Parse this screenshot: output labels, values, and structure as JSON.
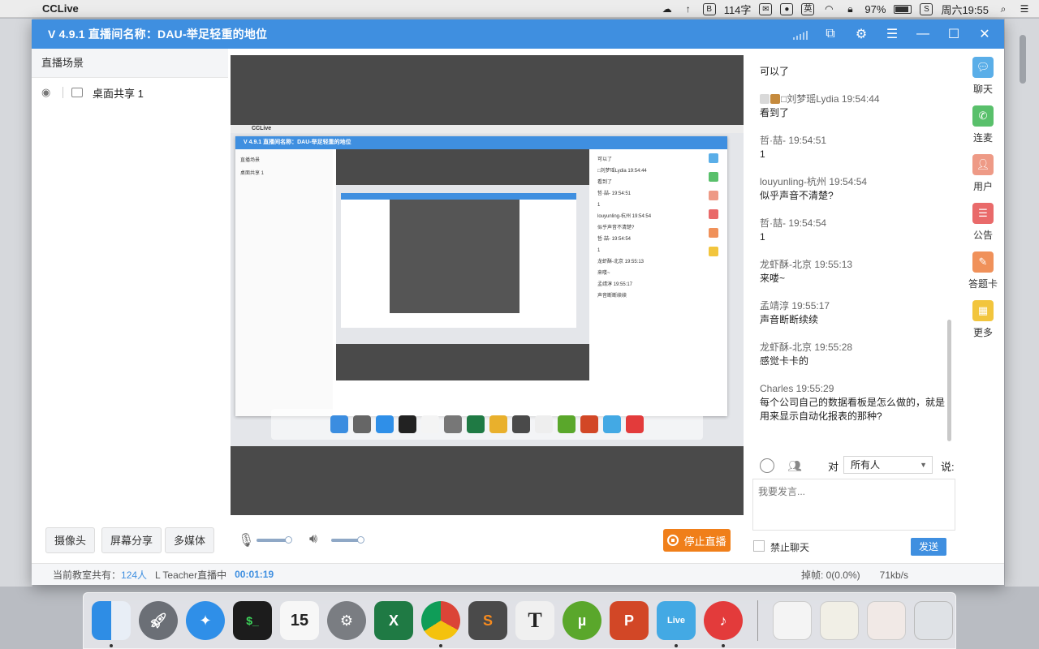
{
  "menubar": {
    "app_name": "CCLive",
    "word_count": "114字",
    "input_method": "英",
    "battery": "97%",
    "clock": "周六19:55"
  },
  "window": {
    "title": "V 4.9.1  直播间名称：DAU-举足轻重的地位"
  },
  "scene_panel": {
    "header": "直播场景",
    "items": [
      {
        "label": "桌面共享 1"
      }
    ]
  },
  "controls": {
    "camera": "摄像头",
    "screen_share": "屏幕分享",
    "multimedia": "多媒体",
    "stop_live": "停止直播"
  },
  "status_bar": {
    "room_prefix": "当前教室共有：",
    "room_count": "124人",
    "teacher_status": "L Teacher直播中",
    "elapsed": "00:01:19",
    "frame_drop": "掉帧: 0(0.0%)",
    "bitrate": "71kb/s"
  },
  "chat": {
    "messages": [
      {
        "meta": "",
        "body": "可以了"
      },
      {
        "meta": "□刘梦瑶Lydia 19:54:44",
        "body": "看到了"
      },
      {
        "meta": "哲·喆- 19:54:51",
        "body": "1"
      },
      {
        "meta": "louyunling-杭州 19:54:54",
        "body": "似乎声音不清楚?"
      },
      {
        "meta": "哲·喆- 19:54:54",
        "body": "1"
      },
      {
        "meta": "龙虾酥-北京 19:55:13",
        "body": "来喽~"
      },
      {
        "meta": "孟靖淳 19:55:17",
        "body": "声音断断续续"
      },
      {
        "meta": "龙虾酥-北京 19:55:28",
        "body": "感觉卡卡的"
      },
      {
        "meta": "Charles 19:55:29",
        "body": "每个公司自己的数据看板是怎么做的，就是用来显示自动化报表的那种?"
      }
    ],
    "to_label": "对",
    "target": "所有人",
    "say_label": "说:",
    "input_placeholder": "我要发言...",
    "mute_label": "禁止聊天",
    "send": "发送"
  },
  "sidebar": {
    "items": [
      {
        "label": "聊天",
        "color": "#5aaee8"
      },
      {
        "label": "连麦",
        "color": "#59c06b"
      },
      {
        "label": "用户",
        "color": "#ee9a86"
      },
      {
        "label": "公告",
        "color": "#e96a6a"
      },
      {
        "label": "答题卡",
        "color": "#f0915a"
      },
      {
        "label": "更多",
        "color": "#f2c53d"
      }
    ]
  },
  "preview_mini": {
    "menubar_app": "CCLive",
    "title": "V 4.9.1  直播间名称：DAU-举足轻重的地位",
    "scene_header": "直播场景",
    "scene_item": "桌面共享 1"
  },
  "colors": {
    "accent": "#3f8fe0",
    "stop": "#f07f1a"
  }
}
